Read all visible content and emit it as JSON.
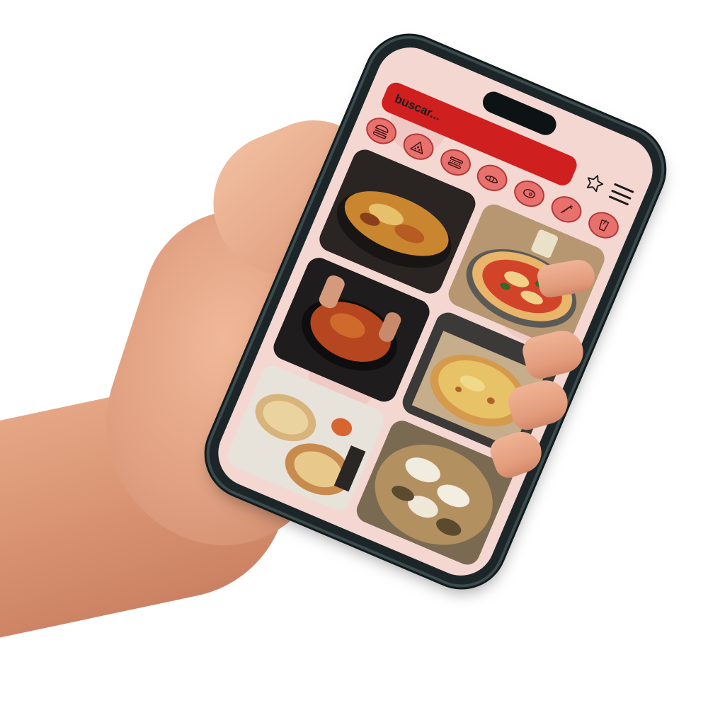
{
  "search": {
    "placeholder": "buscar..."
  },
  "header": {
    "favorites_icon": "star-icon",
    "menu_icon": "hamburger-menu-icon"
  },
  "categories": [
    {
      "icon": "burger-icon"
    },
    {
      "icon": "pizza-slice-icon"
    },
    {
      "icon": "sandwich-icon"
    },
    {
      "icon": "croissant-icon"
    },
    {
      "icon": "steak-icon"
    },
    {
      "icon": "vegetables-icon"
    },
    {
      "icon": "drink-icon"
    }
  ],
  "feed": {
    "photos": [
      {
        "subject": "pizza-in-pan-photo"
      },
      {
        "subject": "margherita-pizza-photo"
      },
      {
        "subject": "pizza-hands-photo"
      },
      {
        "subject": "pizza-in-box-photo"
      },
      {
        "subject": "pizza-table-photo"
      },
      {
        "subject": "white-pizza-photo"
      }
    ]
  },
  "colors": {
    "accent": "#cf1f1f",
    "background": "#f5d7d2",
    "category_fill": "#e8706d",
    "category_border": "#b13a37"
  }
}
